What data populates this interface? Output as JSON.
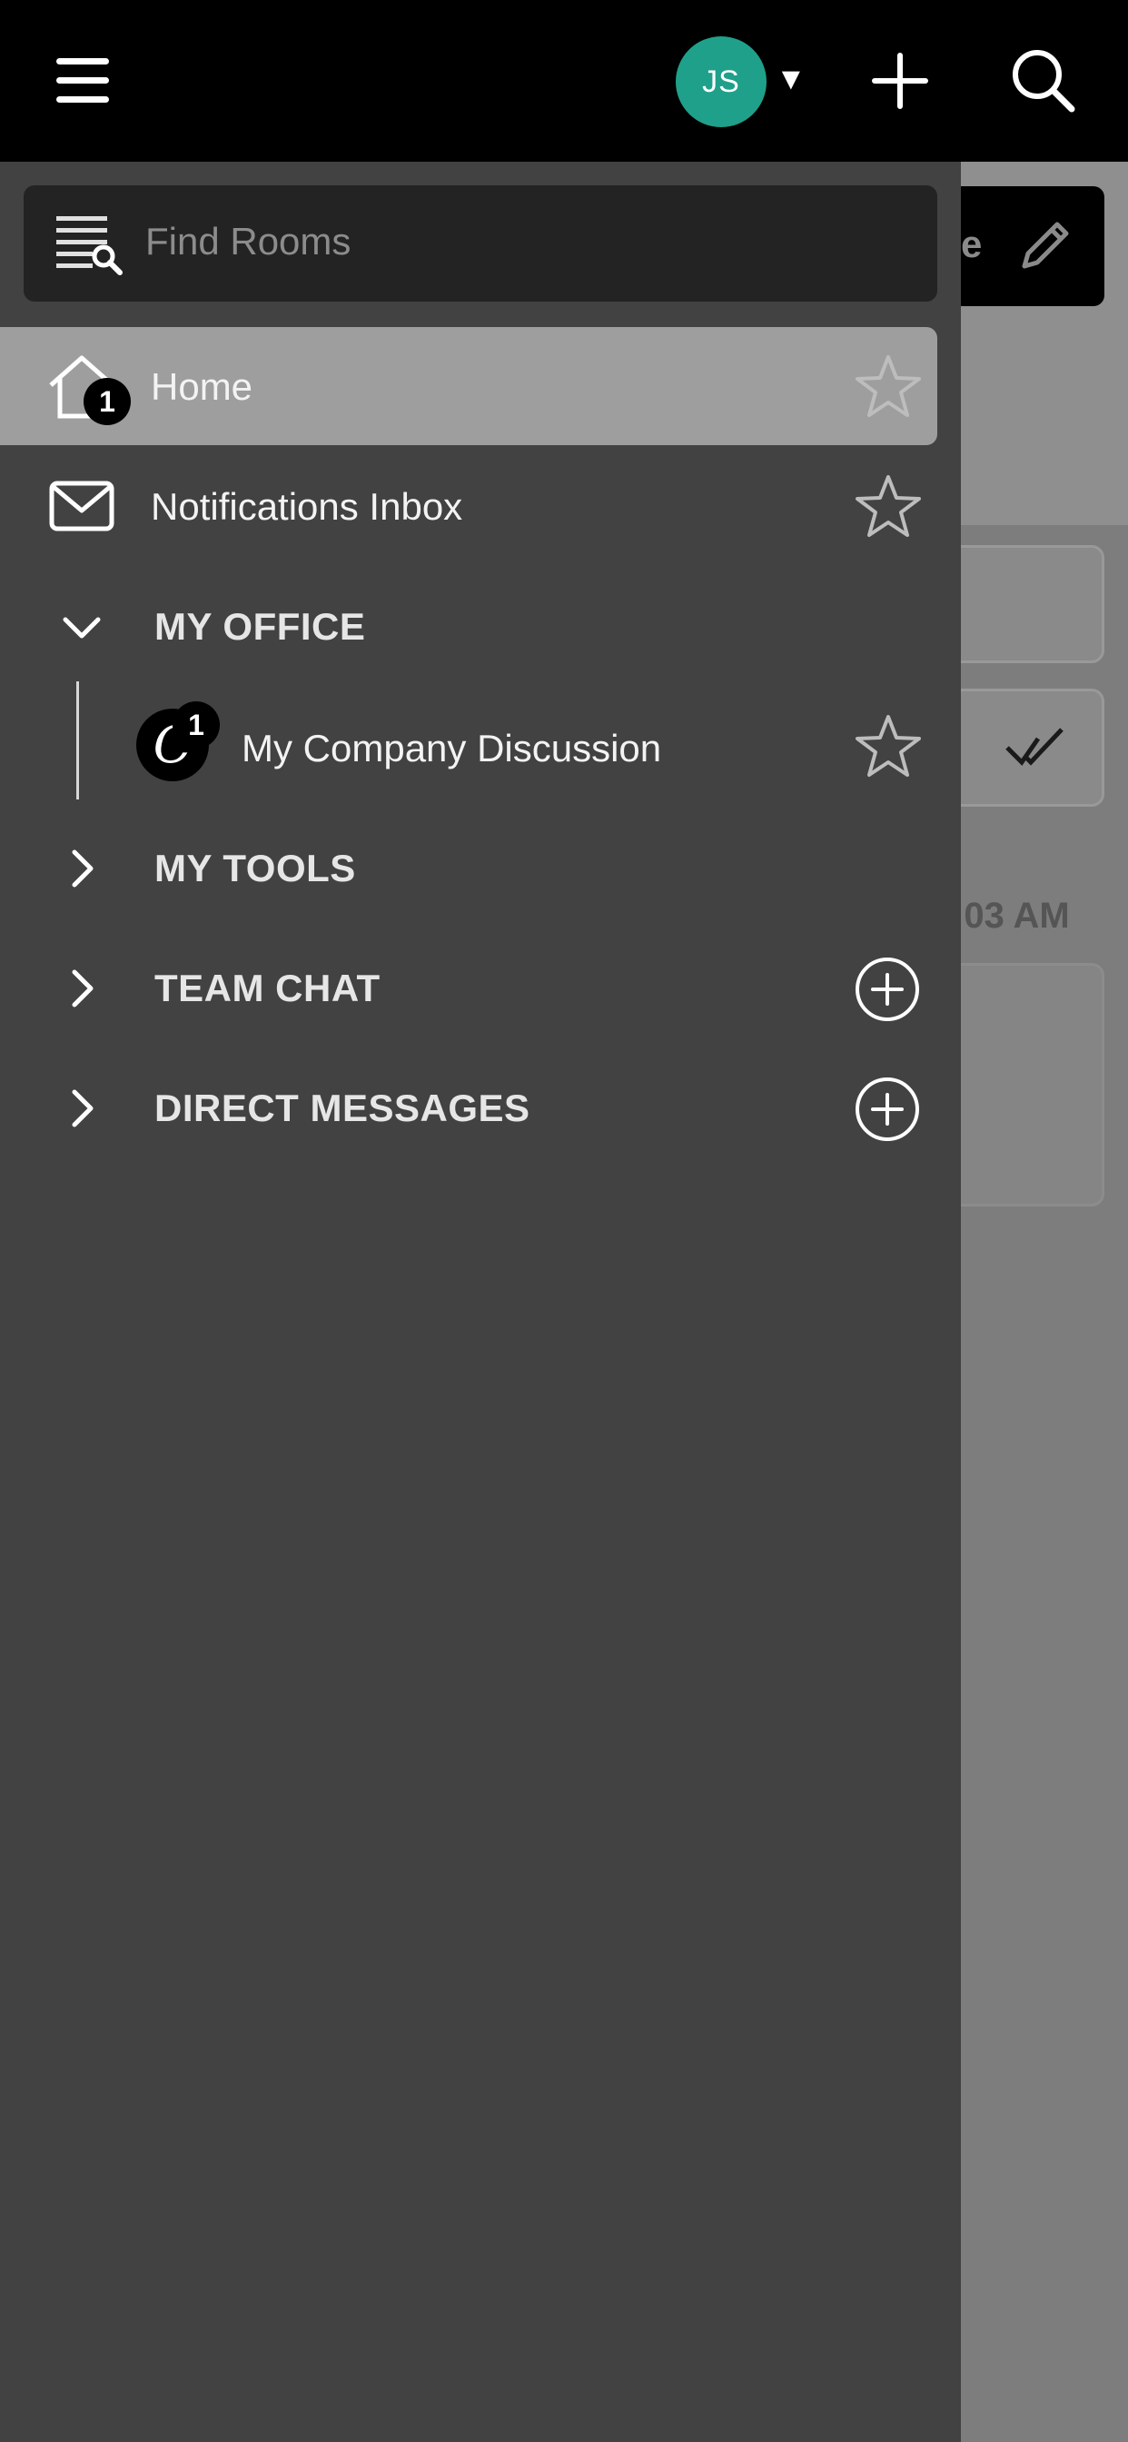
{
  "topbar": {
    "avatar_initials": "JS",
    "avatar_color": "#1fa08a",
    "avatar_caret": "▼"
  },
  "background": {
    "edit_text": "e",
    "time_text": ":03 AM"
  },
  "search": {
    "placeholder": "Find Rooms"
  },
  "nav": {
    "home": {
      "label": "Home",
      "badge": "1"
    },
    "inbox": {
      "label": "Notifications Inbox"
    }
  },
  "sections": {
    "my_office": {
      "title": "MY OFFICE",
      "expanded": true
    },
    "my_tools": {
      "title": "MY TOOLS",
      "expanded": false
    },
    "team_chat": {
      "title": "TEAM CHAT",
      "expanded": false
    },
    "direct_messages": {
      "title": "DIRECT MESSAGES",
      "expanded": false
    }
  },
  "rooms": [
    {
      "label": "My Company Discussion",
      "avatar_letter": "C",
      "badge": "1"
    }
  ],
  "icons": {
    "menu": "hamburger-menu-icon",
    "plus": "plus-icon",
    "search": "search-icon",
    "home": "home-icon",
    "inbox": "envelope-icon",
    "star": "star-outline-icon",
    "add": "plus-circle-icon"
  }
}
